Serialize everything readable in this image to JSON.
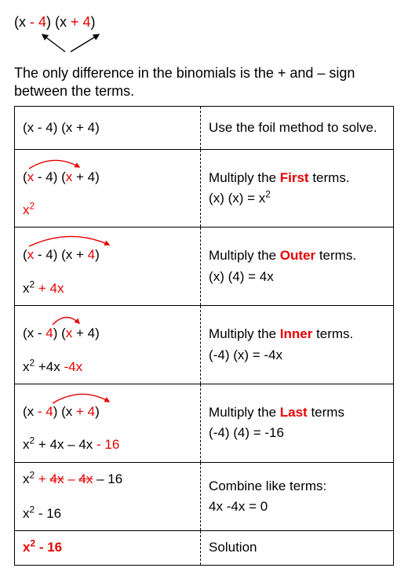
{
  "header": {
    "expr_pre": "(x ",
    "minus": "- 4",
    "mid": ") (x ",
    "plus": "+ 4",
    "post": ")"
  },
  "intro": "The only difference in the binomials is the + and – sign between the terms.",
  "rows": [
    {
      "left_plain": "(x - 4) (x + 4)",
      "right": "Use the foil method to solve."
    },
    {
      "right_pre": "Multiply the ",
      "right_kw": "First",
      "right_post": " terms.",
      "right_calc": " (x) (x)  = x",
      "right_sup": "2",
      "running_pre": "x",
      "running_sup": "2"
    },
    {
      "right_pre": "Multiply the ",
      "right_kw": "Outer",
      "right_post": " terms.",
      "right_calc": " (x) (4)  = 4x",
      "running_pre": "x",
      "running_sup": "2",
      "running_red": " + 4x"
    },
    {
      "right_pre": "Multiply the ",
      "right_kw": "Inner",
      "right_post": " terms.",
      "right_calc": " (-4) (x)  = -4x",
      "running_pre": "x",
      "running_sup": "2",
      "running_mid": " +4x ",
      "running_red": "-4x"
    },
    {
      "right_pre": "Multiply the ",
      "right_kw": "Last",
      "right_post": " terms",
      "right_calc": " (-4) (4)  = -16",
      "running_pre": "x",
      "running_sup": "2",
      "running_mid": " + 4x – 4x ",
      "running_red": "- 16"
    },
    {
      "right_a": "Combine like terms:",
      "right_b": "4x -4x = 0",
      "l1_a": "x",
      "l1_sup": "2",
      "l1_b": " + ",
      "l1_s1": "4x",
      "l1_c": " – ",
      "l1_s2": "4x",
      "l1_d": " – 16",
      "l2_a": "x",
      "l2_sup": "2",
      "l2_b": " - 16"
    },
    {
      "left": "x",
      "left_sup": "2",
      "left_b": " - 16",
      "right": "Solution"
    }
  ]
}
